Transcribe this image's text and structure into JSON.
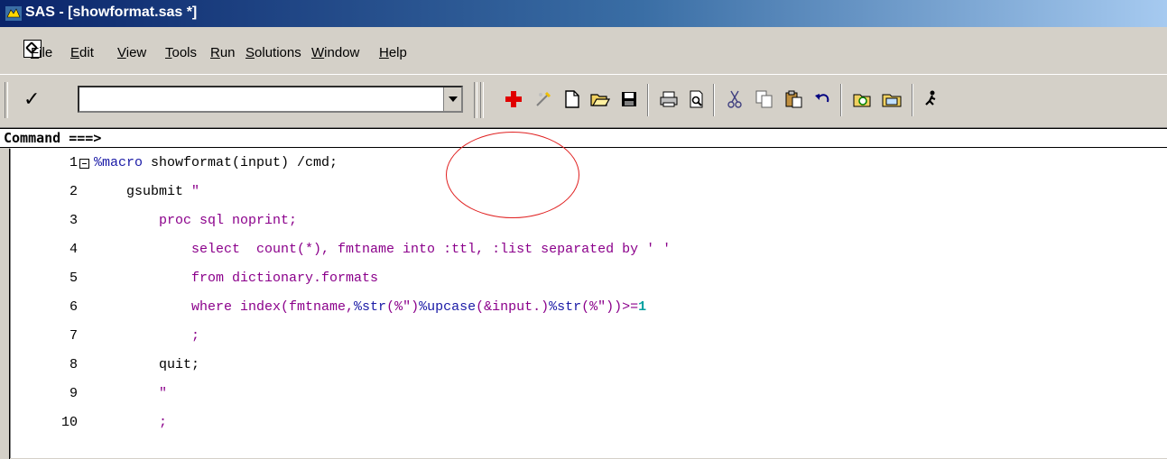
{
  "window": {
    "title": "SAS - [showformat.sas *]"
  },
  "menu": [
    {
      "label": "File",
      "ul": "F",
      "rest": "ile"
    },
    {
      "label": "Edit",
      "ul": "E",
      "rest": "dit"
    },
    {
      "label": "View",
      "ul": "V",
      "rest": "iew"
    },
    {
      "label": "Tools",
      "ul": "T",
      "rest": "ools"
    },
    {
      "label": "Run",
      "ul": "R",
      "rest": "un"
    },
    {
      "label": "Solutions",
      "ul": "S",
      "rest": "olutions"
    },
    {
      "label": "Window",
      "ul": "W",
      "rest": "indow"
    },
    {
      "label": "Help",
      "ul": "H",
      "rest": "elp"
    }
  ],
  "toolbar": {
    "check": "✓",
    "command_value": "",
    "icons": [
      "new-plus",
      "clear-all",
      "new-doc",
      "open-folder",
      "save",
      "print",
      "print-preview",
      "cut",
      "copy",
      "paste",
      "undo",
      "explorer",
      "library",
      "running-man"
    ]
  },
  "command_line": {
    "label": "Command ===>"
  },
  "editor": {
    "lines": [
      {
        "num": "1",
        "fold": true,
        "tokens": [
          [
            "kw",
            "%macro"
          ],
          [
            "txt",
            " showformat(input) /cmd;"
          ]
        ]
      },
      {
        "num": "2",
        "tokens": [
          [
            "txt",
            "    gsubmit "
          ],
          [
            "str",
            "\""
          ]
        ]
      },
      {
        "num": "3",
        "tokens": [
          [
            "str",
            "        proc sql noprint;"
          ]
        ]
      },
      {
        "num": "4",
        "tokens": [
          [
            "str",
            "            select  count(*), fmtname into :ttl, :list separated by ' '"
          ]
        ]
      },
      {
        "num": "5",
        "tokens": [
          [
            "str",
            "            from dictionary.formats"
          ]
        ]
      },
      {
        "num": "6",
        "tokens": [
          [
            "str",
            "            where index(fmtname,"
          ],
          [
            "kw",
            "%str"
          ],
          [
            "str",
            "(%\")"
          ],
          [
            "kw",
            "%upcase"
          ],
          [
            "str",
            "(&input.)"
          ],
          [
            "kw",
            "%str"
          ],
          [
            "str",
            "(%\"))>="
          ],
          [
            "num",
            "1"
          ]
        ]
      },
      {
        "num": "7",
        "tokens": [
          [
            "str",
            "            ;"
          ]
        ]
      },
      {
        "num": "8",
        "tokens": [
          [
            "txt",
            "        quit;"
          ]
        ]
      },
      {
        "num": "9",
        "tokens": [
          [
            "str",
            "        \""
          ]
        ]
      },
      {
        "num": "10",
        "tokens": [
          [
            "str",
            "        ;"
          ]
        ]
      }
    ]
  }
}
